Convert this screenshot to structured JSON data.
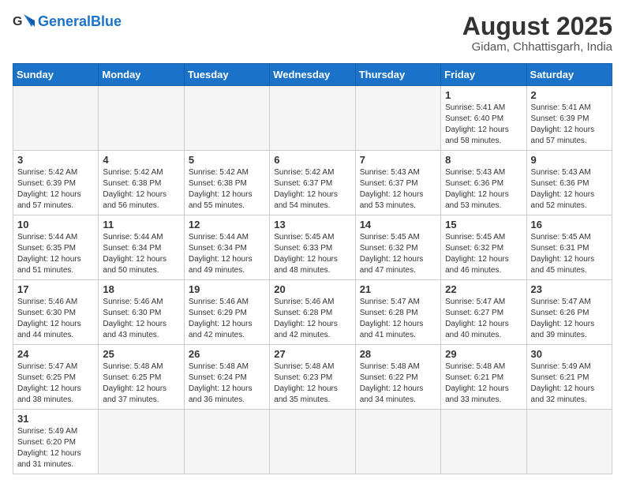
{
  "header": {
    "logo_general": "General",
    "logo_blue": "Blue",
    "month_year": "August 2025",
    "location": "Gidam, Chhattisgarh, India"
  },
  "days_of_week": [
    "Sunday",
    "Monday",
    "Tuesday",
    "Wednesday",
    "Thursday",
    "Friday",
    "Saturday"
  ],
  "weeks": [
    [
      {
        "day": "",
        "info": ""
      },
      {
        "day": "",
        "info": ""
      },
      {
        "day": "",
        "info": ""
      },
      {
        "day": "",
        "info": ""
      },
      {
        "day": "",
        "info": ""
      },
      {
        "day": "1",
        "info": "Sunrise: 5:41 AM\nSunset: 6:40 PM\nDaylight: 12 hours and 58 minutes."
      },
      {
        "day": "2",
        "info": "Sunrise: 5:41 AM\nSunset: 6:39 PM\nDaylight: 12 hours and 57 minutes."
      }
    ],
    [
      {
        "day": "3",
        "info": "Sunrise: 5:42 AM\nSunset: 6:39 PM\nDaylight: 12 hours and 57 minutes."
      },
      {
        "day": "4",
        "info": "Sunrise: 5:42 AM\nSunset: 6:38 PM\nDaylight: 12 hours and 56 minutes."
      },
      {
        "day": "5",
        "info": "Sunrise: 5:42 AM\nSunset: 6:38 PM\nDaylight: 12 hours and 55 minutes."
      },
      {
        "day": "6",
        "info": "Sunrise: 5:42 AM\nSunset: 6:37 PM\nDaylight: 12 hours and 54 minutes."
      },
      {
        "day": "7",
        "info": "Sunrise: 5:43 AM\nSunset: 6:37 PM\nDaylight: 12 hours and 53 minutes."
      },
      {
        "day": "8",
        "info": "Sunrise: 5:43 AM\nSunset: 6:36 PM\nDaylight: 12 hours and 53 minutes."
      },
      {
        "day": "9",
        "info": "Sunrise: 5:43 AM\nSunset: 6:36 PM\nDaylight: 12 hours and 52 minutes."
      }
    ],
    [
      {
        "day": "10",
        "info": "Sunrise: 5:44 AM\nSunset: 6:35 PM\nDaylight: 12 hours and 51 minutes."
      },
      {
        "day": "11",
        "info": "Sunrise: 5:44 AM\nSunset: 6:34 PM\nDaylight: 12 hours and 50 minutes."
      },
      {
        "day": "12",
        "info": "Sunrise: 5:44 AM\nSunset: 6:34 PM\nDaylight: 12 hours and 49 minutes."
      },
      {
        "day": "13",
        "info": "Sunrise: 5:45 AM\nSunset: 6:33 PM\nDaylight: 12 hours and 48 minutes."
      },
      {
        "day": "14",
        "info": "Sunrise: 5:45 AM\nSunset: 6:32 PM\nDaylight: 12 hours and 47 minutes."
      },
      {
        "day": "15",
        "info": "Sunrise: 5:45 AM\nSunset: 6:32 PM\nDaylight: 12 hours and 46 minutes."
      },
      {
        "day": "16",
        "info": "Sunrise: 5:45 AM\nSunset: 6:31 PM\nDaylight: 12 hours and 45 minutes."
      }
    ],
    [
      {
        "day": "17",
        "info": "Sunrise: 5:46 AM\nSunset: 6:30 PM\nDaylight: 12 hours and 44 minutes."
      },
      {
        "day": "18",
        "info": "Sunrise: 5:46 AM\nSunset: 6:30 PM\nDaylight: 12 hours and 43 minutes."
      },
      {
        "day": "19",
        "info": "Sunrise: 5:46 AM\nSunset: 6:29 PM\nDaylight: 12 hours and 42 minutes."
      },
      {
        "day": "20",
        "info": "Sunrise: 5:46 AM\nSunset: 6:28 PM\nDaylight: 12 hours and 42 minutes."
      },
      {
        "day": "21",
        "info": "Sunrise: 5:47 AM\nSunset: 6:28 PM\nDaylight: 12 hours and 41 minutes."
      },
      {
        "day": "22",
        "info": "Sunrise: 5:47 AM\nSunset: 6:27 PM\nDaylight: 12 hours and 40 minutes."
      },
      {
        "day": "23",
        "info": "Sunrise: 5:47 AM\nSunset: 6:26 PM\nDaylight: 12 hours and 39 minutes."
      }
    ],
    [
      {
        "day": "24",
        "info": "Sunrise: 5:47 AM\nSunset: 6:25 PM\nDaylight: 12 hours and 38 minutes."
      },
      {
        "day": "25",
        "info": "Sunrise: 5:48 AM\nSunset: 6:25 PM\nDaylight: 12 hours and 37 minutes."
      },
      {
        "day": "26",
        "info": "Sunrise: 5:48 AM\nSunset: 6:24 PM\nDaylight: 12 hours and 36 minutes."
      },
      {
        "day": "27",
        "info": "Sunrise: 5:48 AM\nSunset: 6:23 PM\nDaylight: 12 hours and 35 minutes."
      },
      {
        "day": "28",
        "info": "Sunrise: 5:48 AM\nSunset: 6:22 PM\nDaylight: 12 hours and 34 minutes."
      },
      {
        "day": "29",
        "info": "Sunrise: 5:48 AM\nSunset: 6:21 PM\nDaylight: 12 hours and 33 minutes."
      },
      {
        "day": "30",
        "info": "Sunrise: 5:49 AM\nSunset: 6:21 PM\nDaylight: 12 hours and 32 minutes."
      }
    ],
    [
      {
        "day": "31",
        "info": "Sunrise: 5:49 AM\nSunset: 6:20 PM\nDaylight: 12 hours and 31 minutes."
      },
      {
        "day": "",
        "info": ""
      },
      {
        "day": "",
        "info": ""
      },
      {
        "day": "",
        "info": ""
      },
      {
        "day": "",
        "info": ""
      },
      {
        "day": "",
        "info": ""
      },
      {
        "day": "",
        "info": ""
      }
    ]
  ]
}
